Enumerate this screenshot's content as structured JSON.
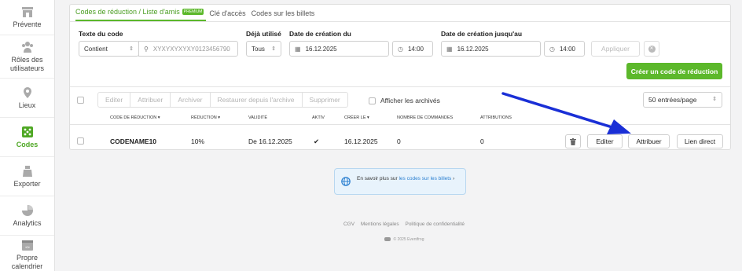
{
  "sidebar": {
    "items": [
      {
        "label": "Prévente",
        "icon": "storefront-icon",
        "active": false
      },
      {
        "label": "Rôles des utilisateurs",
        "icon": "users-icon",
        "active": false
      },
      {
        "label": "Lieux",
        "icon": "location-pin-icon",
        "active": false
      },
      {
        "label": "Codes",
        "icon": "dice-icon",
        "active": true
      },
      {
        "label": "Exporter",
        "icon": "bag-icon",
        "active": false
      },
      {
        "label": "Analytics",
        "icon": "pie-chart-icon",
        "active": false
      },
      {
        "label": "Propre calendrier",
        "icon": "calendar-code-icon",
        "active": false
      }
    ]
  },
  "tabs": [
    {
      "label": "Codes de réduction / Liste d'amis",
      "badge": "PREMIUM",
      "active": true
    },
    {
      "label": "Clé d'accès",
      "active": false
    },
    {
      "label": "Codes sur les billets",
      "active": false
    }
  ],
  "filters": {
    "code_text": {
      "label": "Texte du code",
      "mode": "Contient",
      "placeholder": "XYXYXYXYXY0123456790"
    },
    "used": {
      "label": "Déjà utilisé",
      "value": "Tous"
    },
    "created_from": {
      "label": "Date de création du",
      "date": "16.12.2025",
      "time": "14:00"
    },
    "created_until": {
      "label": "Date de création jusqu'au",
      "date": "16.12.2025",
      "time": "14:00"
    },
    "apply_label": "Appliquer"
  },
  "create_button": "Créer un code de réduction",
  "bulk_actions": [
    "Editer",
    "Attribuer",
    "Archiver",
    "Restaurer depuis l'archive",
    "Supprimer"
  ],
  "show_archived": "Afficher les archivés",
  "per_page": "50 entrées/page",
  "table": {
    "headers": [
      "CODE DE RÉDUCTION",
      "RÉDUCTION",
      "VALIDITÉ",
      "AKTIV",
      "CRÉER LE",
      "NOMBRE DE COMMANDES",
      "ATTRIBUTIONS"
    ],
    "rows": [
      {
        "code": "CODENAME10",
        "reduction": "10%",
        "validity": "De 16.12.2025",
        "active": "✔",
        "created": "16.12.2025",
        "orders": "0",
        "attributions": "0"
      }
    ],
    "row_actions": {
      "edit": "Editer",
      "assign": "Attribuer",
      "direct_link": "Lien direct"
    }
  },
  "info": {
    "prefix": "En savoir plus sur ",
    "link": "les codes sur les billets",
    "suffix": " ›"
  },
  "footer": {
    "links": [
      "CGV",
      "Mentions légales",
      "Politique de confidentialité"
    ],
    "copyright": "© 2025 Eventfrog"
  },
  "colors": {
    "accent": "#5cb82b",
    "arrow": "#1a2fd6",
    "info_bg": "#e8f3fc"
  }
}
